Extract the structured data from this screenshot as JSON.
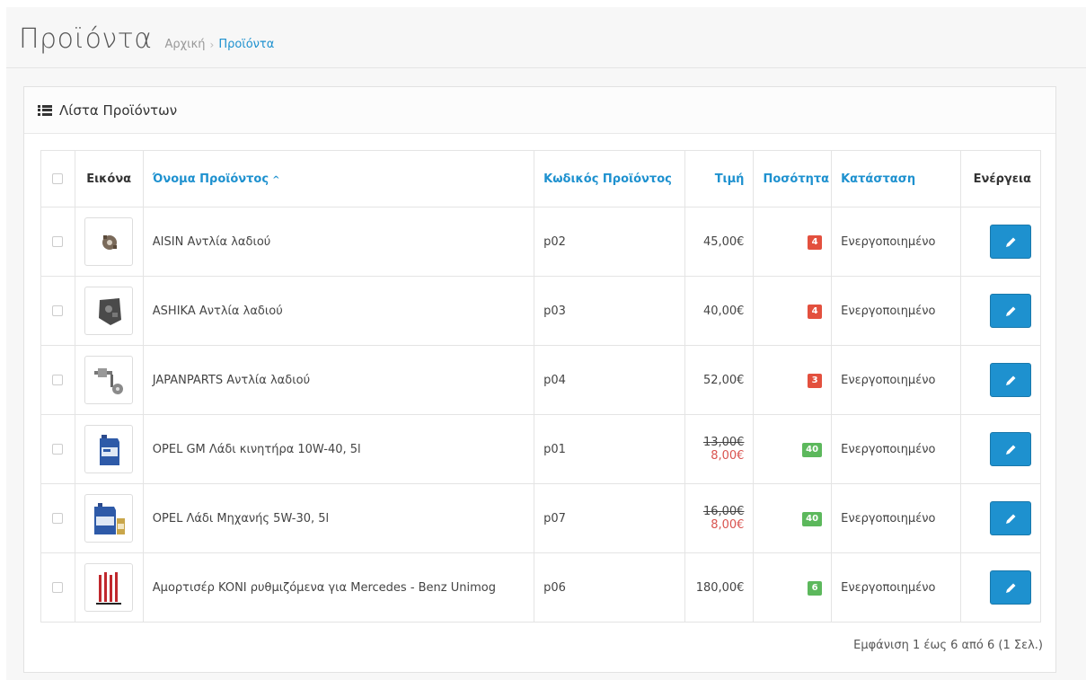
{
  "header": {
    "title": "Προϊόντα",
    "breadcrumb": [
      {
        "label": "Αρχική"
      },
      {
        "label": "Προϊόντα"
      }
    ],
    "breadcrumb_separator": "›"
  },
  "panel": {
    "title": "Λίστα Προϊόντων"
  },
  "table": {
    "columns": {
      "image": "Εικόνα",
      "name": "Όνομα Προϊόντος",
      "name_sort": "^",
      "code": "Κωδικός Προϊόντος",
      "price": "Τιμή",
      "quantity": "Ποσότητα",
      "status": "Κατάσταση",
      "action": "Ενέργεια"
    },
    "rows": [
      {
        "name": "AISIN Αντλία λαδιού",
        "code": "p02",
        "price": "45,00€",
        "quantity": "4",
        "status": "Ενεργοποιημένο"
      },
      {
        "name": "ASHIKA Αντλία λαδιού",
        "code": "p03",
        "price": "40,00€",
        "quantity": "4",
        "status": "Ενεργοποιημένο"
      },
      {
        "name": "JAPANPARTS Αντλία λαδιού",
        "code": "p04",
        "price": "52,00€",
        "quantity": "3",
        "status": "Ενεργοποιημένο"
      },
      {
        "name": "OPEL GM Λάδι κινητήρα 10W-40, 5l",
        "code": "p01",
        "old_price": "13,00€",
        "price": "8,00€",
        "quantity": "40",
        "status": "Ενεργοποιημένο"
      },
      {
        "name": "OPEL Λάδι Μηχανής 5W-30, 5l",
        "code": "p07",
        "old_price": "16,00€",
        "price": "8,00€",
        "quantity": "40",
        "status": "Ενεργοποιημένο"
      },
      {
        "name": "Αμορτισέρ KONI ρυθμιζόμενα για Mercedes - Benz Unimog",
        "code": "p06",
        "price": "180,00€",
        "quantity": "6",
        "status": "Ενεργοποιημένο"
      }
    ]
  },
  "pagination": {
    "summary": "Εμφάνιση 1 έως 6 από 6 (1 Σελ.)"
  },
  "colors": {
    "accent": "#1e91cf",
    "danger": "#e3503e",
    "success": "#5cb85c",
    "sale_price": "#d9534f"
  },
  "icons": {
    "panel": "list-icon",
    "edit": "pencil-icon"
  }
}
